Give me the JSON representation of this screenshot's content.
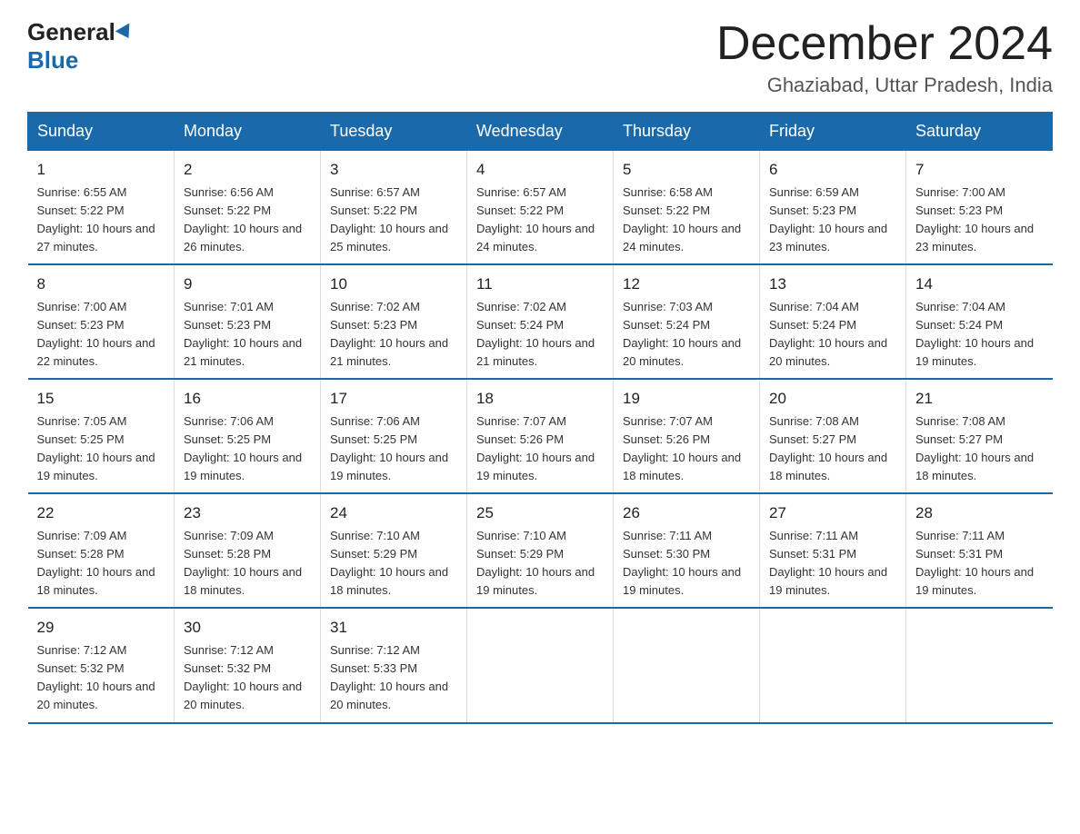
{
  "logo": {
    "text_general": "General",
    "text_blue": "Blue"
  },
  "title": "December 2024",
  "location": "Ghaziabad, Uttar Pradesh, India",
  "days_of_week": [
    "Sunday",
    "Monday",
    "Tuesday",
    "Wednesday",
    "Thursday",
    "Friday",
    "Saturday"
  ],
  "weeks": [
    [
      {
        "day": 1,
        "sunrise": "Sunrise: 6:55 AM",
        "sunset": "Sunset: 5:22 PM",
        "daylight": "Daylight: 10 hours and 27 minutes."
      },
      {
        "day": 2,
        "sunrise": "Sunrise: 6:56 AM",
        "sunset": "Sunset: 5:22 PM",
        "daylight": "Daylight: 10 hours and 26 minutes."
      },
      {
        "day": 3,
        "sunrise": "Sunrise: 6:57 AM",
        "sunset": "Sunset: 5:22 PM",
        "daylight": "Daylight: 10 hours and 25 minutes."
      },
      {
        "day": 4,
        "sunrise": "Sunrise: 6:57 AM",
        "sunset": "Sunset: 5:22 PM",
        "daylight": "Daylight: 10 hours and 24 minutes."
      },
      {
        "day": 5,
        "sunrise": "Sunrise: 6:58 AM",
        "sunset": "Sunset: 5:22 PM",
        "daylight": "Daylight: 10 hours and 24 minutes."
      },
      {
        "day": 6,
        "sunrise": "Sunrise: 6:59 AM",
        "sunset": "Sunset: 5:23 PM",
        "daylight": "Daylight: 10 hours and 23 minutes."
      },
      {
        "day": 7,
        "sunrise": "Sunrise: 7:00 AM",
        "sunset": "Sunset: 5:23 PM",
        "daylight": "Daylight: 10 hours and 23 minutes."
      }
    ],
    [
      {
        "day": 8,
        "sunrise": "Sunrise: 7:00 AM",
        "sunset": "Sunset: 5:23 PM",
        "daylight": "Daylight: 10 hours and 22 minutes."
      },
      {
        "day": 9,
        "sunrise": "Sunrise: 7:01 AM",
        "sunset": "Sunset: 5:23 PM",
        "daylight": "Daylight: 10 hours and 21 minutes."
      },
      {
        "day": 10,
        "sunrise": "Sunrise: 7:02 AM",
        "sunset": "Sunset: 5:23 PM",
        "daylight": "Daylight: 10 hours and 21 minutes."
      },
      {
        "day": 11,
        "sunrise": "Sunrise: 7:02 AM",
        "sunset": "Sunset: 5:24 PM",
        "daylight": "Daylight: 10 hours and 21 minutes."
      },
      {
        "day": 12,
        "sunrise": "Sunrise: 7:03 AM",
        "sunset": "Sunset: 5:24 PM",
        "daylight": "Daylight: 10 hours and 20 minutes."
      },
      {
        "day": 13,
        "sunrise": "Sunrise: 7:04 AM",
        "sunset": "Sunset: 5:24 PM",
        "daylight": "Daylight: 10 hours and 20 minutes."
      },
      {
        "day": 14,
        "sunrise": "Sunrise: 7:04 AM",
        "sunset": "Sunset: 5:24 PM",
        "daylight": "Daylight: 10 hours and 19 minutes."
      }
    ],
    [
      {
        "day": 15,
        "sunrise": "Sunrise: 7:05 AM",
        "sunset": "Sunset: 5:25 PM",
        "daylight": "Daylight: 10 hours and 19 minutes."
      },
      {
        "day": 16,
        "sunrise": "Sunrise: 7:06 AM",
        "sunset": "Sunset: 5:25 PM",
        "daylight": "Daylight: 10 hours and 19 minutes."
      },
      {
        "day": 17,
        "sunrise": "Sunrise: 7:06 AM",
        "sunset": "Sunset: 5:25 PM",
        "daylight": "Daylight: 10 hours and 19 minutes."
      },
      {
        "day": 18,
        "sunrise": "Sunrise: 7:07 AM",
        "sunset": "Sunset: 5:26 PM",
        "daylight": "Daylight: 10 hours and 19 minutes."
      },
      {
        "day": 19,
        "sunrise": "Sunrise: 7:07 AM",
        "sunset": "Sunset: 5:26 PM",
        "daylight": "Daylight: 10 hours and 18 minutes."
      },
      {
        "day": 20,
        "sunrise": "Sunrise: 7:08 AM",
        "sunset": "Sunset: 5:27 PM",
        "daylight": "Daylight: 10 hours and 18 minutes."
      },
      {
        "day": 21,
        "sunrise": "Sunrise: 7:08 AM",
        "sunset": "Sunset: 5:27 PM",
        "daylight": "Daylight: 10 hours and 18 minutes."
      }
    ],
    [
      {
        "day": 22,
        "sunrise": "Sunrise: 7:09 AM",
        "sunset": "Sunset: 5:28 PM",
        "daylight": "Daylight: 10 hours and 18 minutes."
      },
      {
        "day": 23,
        "sunrise": "Sunrise: 7:09 AM",
        "sunset": "Sunset: 5:28 PM",
        "daylight": "Daylight: 10 hours and 18 minutes."
      },
      {
        "day": 24,
        "sunrise": "Sunrise: 7:10 AM",
        "sunset": "Sunset: 5:29 PM",
        "daylight": "Daylight: 10 hours and 18 minutes."
      },
      {
        "day": 25,
        "sunrise": "Sunrise: 7:10 AM",
        "sunset": "Sunset: 5:29 PM",
        "daylight": "Daylight: 10 hours and 19 minutes."
      },
      {
        "day": 26,
        "sunrise": "Sunrise: 7:11 AM",
        "sunset": "Sunset: 5:30 PM",
        "daylight": "Daylight: 10 hours and 19 minutes."
      },
      {
        "day": 27,
        "sunrise": "Sunrise: 7:11 AM",
        "sunset": "Sunset: 5:31 PM",
        "daylight": "Daylight: 10 hours and 19 minutes."
      },
      {
        "day": 28,
        "sunrise": "Sunrise: 7:11 AM",
        "sunset": "Sunset: 5:31 PM",
        "daylight": "Daylight: 10 hours and 19 minutes."
      }
    ],
    [
      {
        "day": 29,
        "sunrise": "Sunrise: 7:12 AM",
        "sunset": "Sunset: 5:32 PM",
        "daylight": "Daylight: 10 hours and 20 minutes."
      },
      {
        "day": 30,
        "sunrise": "Sunrise: 7:12 AM",
        "sunset": "Sunset: 5:32 PM",
        "daylight": "Daylight: 10 hours and 20 minutes."
      },
      {
        "day": 31,
        "sunrise": "Sunrise: 7:12 AM",
        "sunset": "Sunset: 5:33 PM",
        "daylight": "Daylight: 10 hours and 20 minutes."
      },
      null,
      null,
      null,
      null
    ]
  ]
}
